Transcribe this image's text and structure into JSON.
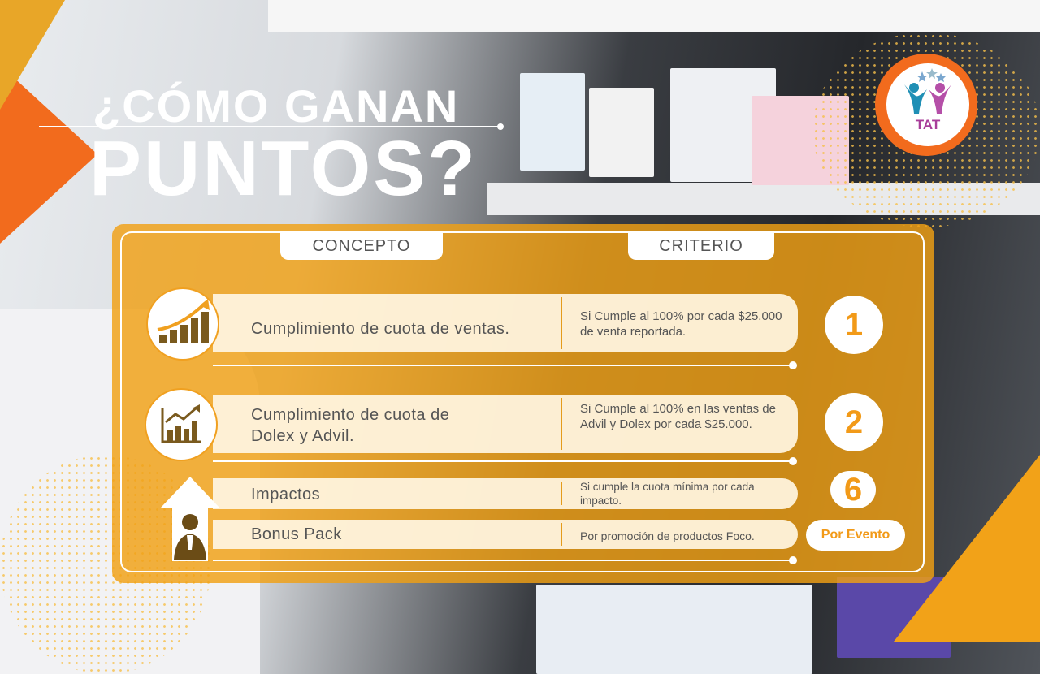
{
  "title": {
    "line1": "¿CÓMO GANAN",
    "line2": "PUNTOS?"
  },
  "logo": {
    "text": "TAT"
  },
  "colors": {
    "accent_orange": "#f26b1d",
    "panel_yellow": "#f0a020",
    "text_gray": "#555555"
  },
  "table": {
    "headers": {
      "concept": "CONCEPTO",
      "criterion": "CRITERIO"
    },
    "rows": [
      {
        "concept": "Cumplimiento de cuota de ventas.",
        "criterion": "Si Cumple al 100% por cada $25.000 de venta reportada.",
        "points": "1",
        "icon": "growth-bar-chart-icon"
      },
      {
        "concept": "Cumplimiento de cuota de Dolex y Advil.",
        "criterion": "Si Cumple al 100% en las ventas de Advil  y Dolex por cada $25.000.",
        "points": "2",
        "icon": "line-bar-chart-icon"
      },
      {
        "concept": "Impactos",
        "criterion": "Si cumple la cuota mínima por cada impacto.",
        "points": "6",
        "icon": "person-up-arrow-icon"
      },
      {
        "concept": "Bonus Pack",
        "criterion": "Por promoción de productos Foco.",
        "points": "Por Evento",
        "icon": ""
      }
    ]
  }
}
